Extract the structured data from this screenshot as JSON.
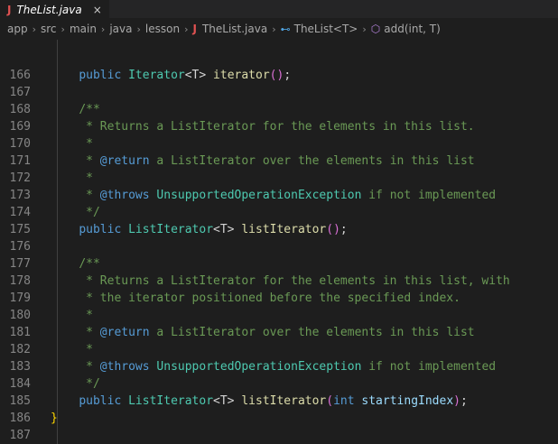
{
  "tab": {
    "title": "TheList.java",
    "close": "×",
    "file_icon": "java-icon"
  },
  "breadcrumb": {
    "items": [
      "app",
      "src",
      "main",
      "java",
      "lesson",
      "TheList.java",
      "TheList<T>",
      "add(int, T)"
    ],
    "separator": "›"
  },
  "code": {
    "lines": [
      {
        "n": "166",
        "t": [
          [
            "    ",
            ""
          ],
          [
            "public",
            "kw"
          ],
          [
            " ",
            ""
          ],
          [
            "Iterator",
            "type"
          ],
          [
            "<T> ",
            ""
          ],
          [
            "iterator",
            "fn"
          ],
          [
            "()",
            "paren"
          ],
          [
            ";",
            "punc"
          ]
        ]
      },
      {
        "n": "167",
        "t": []
      },
      {
        "n": "168",
        "t": [
          [
            "    ",
            ""
          ],
          [
            "/**",
            "cm"
          ]
        ]
      },
      {
        "n": "169",
        "t": [
          [
            "     ",
            ""
          ],
          [
            "* Returns a ListIterator for the elements in this list.",
            "cm"
          ]
        ]
      },
      {
        "n": "170",
        "t": [
          [
            "     ",
            ""
          ],
          [
            "*",
            "cm"
          ]
        ]
      },
      {
        "n": "171",
        "t": [
          [
            "     ",
            ""
          ],
          [
            "* ",
            "cm"
          ],
          [
            "@return",
            "tag"
          ],
          [
            " a ListIterator over the elements in this list",
            "cm"
          ]
        ]
      },
      {
        "n": "172",
        "t": [
          [
            "     ",
            ""
          ],
          [
            "*",
            "cm"
          ]
        ]
      },
      {
        "n": "173",
        "t": [
          [
            "     ",
            ""
          ],
          [
            "* ",
            "cm"
          ],
          [
            "@throws",
            "tag"
          ],
          [
            " ",
            ""
          ],
          [
            "UnsupportedOperationException",
            "exc"
          ],
          [
            " if not implemented",
            "cm"
          ]
        ]
      },
      {
        "n": "174",
        "t": [
          [
            "     ",
            ""
          ],
          [
            "*/",
            "cm"
          ]
        ]
      },
      {
        "n": "175",
        "t": [
          [
            "    ",
            ""
          ],
          [
            "public",
            "kw"
          ],
          [
            " ",
            ""
          ],
          [
            "ListIterator",
            "type"
          ],
          [
            "<T> ",
            ""
          ],
          [
            "listIterator",
            "fn"
          ],
          [
            "()",
            "paren"
          ],
          [
            ";",
            "punc"
          ]
        ]
      },
      {
        "n": "176",
        "t": []
      },
      {
        "n": "177",
        "t": [
          [
            "    ",
            ""
          ],
          [
            "/**",
            "cm"
          ]
        ]
      },
      {
        "n": "178",
        "t": [
          [
            "     ",
            ""
          ],
          [
            "* Returns a ListIterator for the elements in this list, with",
            "cm"
          ]
        ]
      },
      {
        "n": "179",
        "t": [
          [
            "     ",
            ""
          ],
          [
            "* the iterator positioned before the specified index.",
            "cm"
          ]
        ]
      },
      {
        "n": "180",
        "t": [
          [
            "     ",
            ""
          ],
          [
            "*",
            "cm"
          ]
        ]
      },
      {
        "n": "181",
        "t": [
          [
            "     ",
            ""
          ],
          [
            "* ",
            "cm"
          ],
          [
            "@return",
            "tag"
          ],
          [
            " a ListIterator over the elements in this list",
            "cm"
          ]
        ]
      },
      {
        "n": "182",
        "t": [
          [
            "     ",
            ""
          ],
          [
            "*",
            "cm"
          ]
        ]
      },
      {
        "n": "183",
        "t": [
          [
            "     ",
            ""
          ],
          [
            "* ",
            "cm"
          ],
          [
            "@throws",
            "tag"
          ],
          [
            " ",
            ""
          ],
          [
            "UnsupportedOperationException",
            "exc"
          ],
          [
            " if not implemented",
            "cm"
          ]
        ]
      },
      {
        "n": "184",
        "t": [
          [
            "     ",
            ""
          ],
          [
            "*/",
            "cm"
          ]
        ]
      },
      {
        "n": "185",
        "t": [
          [
            "    ",
            ""
          ],
          [
            "public",
            "kw"
          ],
          [
            " ",
            ""
          ],
          [
            "ListIterator",
            "type"
          ],
          [
            "<T> ",
            ""
          ],
          [
            "listIterator",
            "fn"
          ],
          [
            "(",
            "paren"
          ],
          [
            "int",
            "kw"
          ],
          [
            " ",
            ""
          ],
          [
            "startingIndex",
            "par"
          ],
          [
            ")",
            "paren"
          ],
          [
            ";",
            "punc"
          ]
        ]
      },
      {
        "n": "186",
        "t": [
          [
            "}",
            "brace"
          ]
        ]
      },
      {
        "n": "187",
        "t": []
      }
    ]
  },
  "colors": {
    "background": "#1e1e1e",
    "keyword": "#569cd6",
    "type": "#4ec9b0",
    "function": "#dcdcaa",
    "comment": "#6a9955",
    "parameter": "#9cdcfe",
    "line_number": "#858585"
  }
}
